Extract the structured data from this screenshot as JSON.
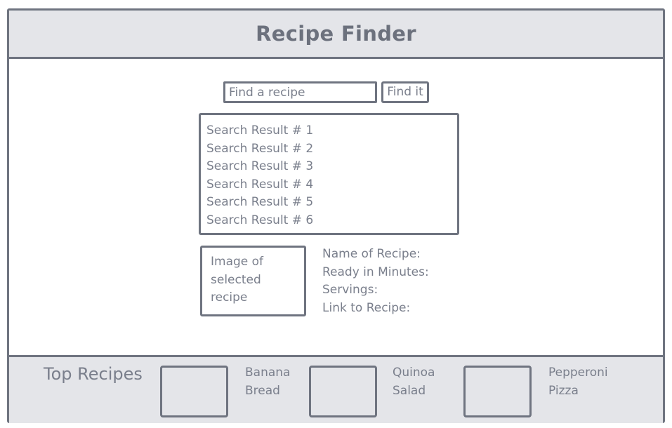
{
  "header": {
    "title": "Recipe Finder"
  },
  "search": {
    "placeholder": "Find a recipe",
    "button_label": "Find it"
  },
  "results": [
    "Search Result # 1",
    "Search Result # 2",
    "Search Result # 3",
    "Search Result # 4",
    "Search Result # 5",
    "Search Result # 6"
  ],
  "selected": {
    "image_placeholder": "Image of selected recipe",
    "fields": [
      "Name of Recipe:",
      "Ready in Minutes:",
      "Servings:",
      "Link to Recipe:"
    ]
  },
  "top_recipes": {
    "title": "Top Recipes",
    "items": [
      {
        "line1": "Banana",
        "line2": "Bread"
      },
      {
        "line1": "Quinoa",
        "line2": "Salad"
      },
      {
        "line1": "Pepperoni",
        "line2": "Pizza"
      }
    ]
  },
  "colors": {
    "border": "#6f7480",
    "text": "#7a7f8c",
    "panel_background": "#e4e5e9"
  }
}
